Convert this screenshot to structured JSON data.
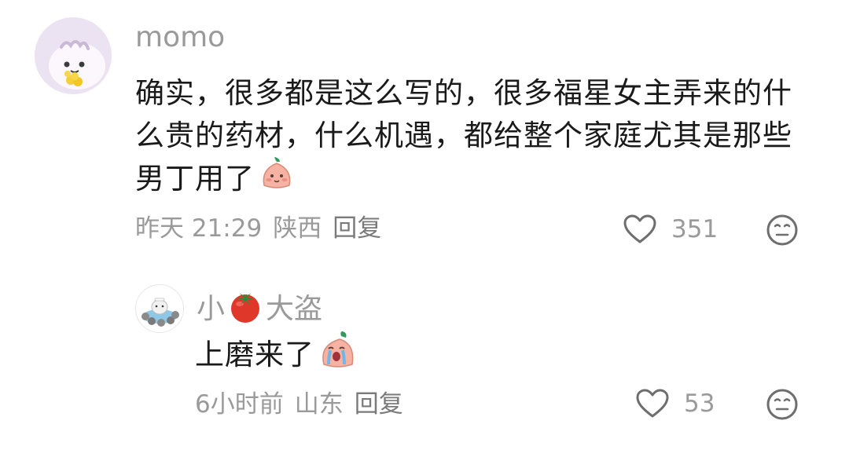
{
  "comments": [
    {
      "username": "momo",
      "text": "确实，很多都是这么写的，很多福星女主弄来的什么贵的药材，什么机遇，都给整个家庭尤其是那些男丁用了",
      "emoji": "blush-peach-emoji",
      "time": "昨天 21:29",
      "location": "陕西",
      "reply_label": "回复",
      "likes": "351",
      "avatar_icon": "cartoon-dumpling-avatar-icon"
    },
    {
      "username_prefix": "小",
      "username_suffix": "大盗",
      "username_emoji": "tomato-emoji",
      "text": "上磨来了",
      "emoji": "crying-peach-emoji",
      "time": "6小时前",
      "location": "山东",
      "reply_label": "回复",
      "likes": "53",
      "avatar_icon": "seal-in-hot-spring-avatar-icon"
    }
  ],
  "icons": {
    "like": "heart-outline-icon",
    "dislike": "meh-face-icon"
  },
  "colors": {
    "text_primary": "#1a1a1a",
    "text_secondary": "#9a9a9a",
    "avatar_bg": "#eee4f3"
  }
}
